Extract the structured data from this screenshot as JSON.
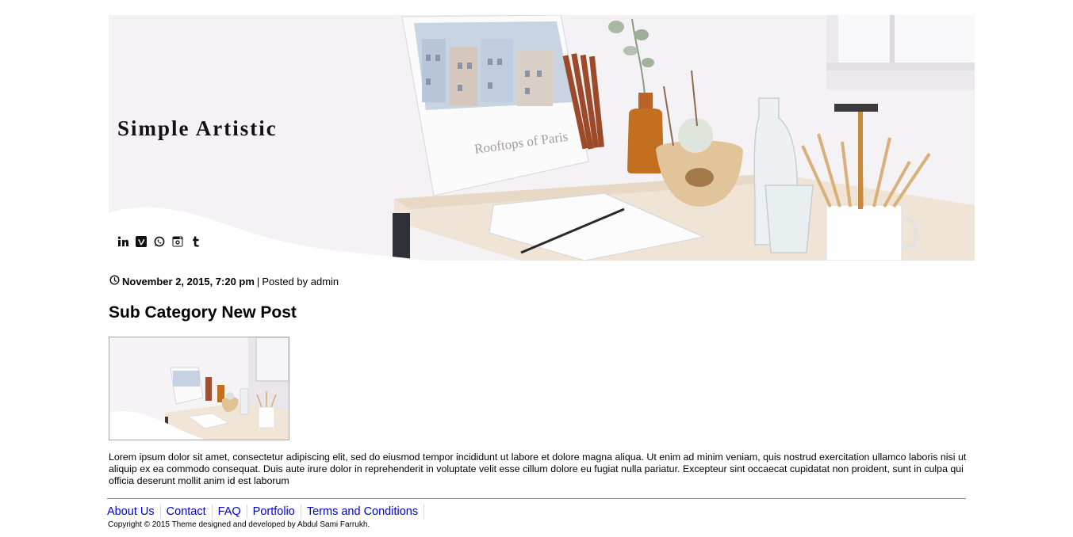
{
  "header": {
    "site_title": "Simple Artistic",
    "banner_image": "desk-workspace-photo",
    "book_cover_text": "Rooftops of Paris"
  },
  "social": [
    {
      "name": "linkedin-icon",
      "glyph": "in"
    },
    {
      "name": "vimeo-icon",
      "glyph": "v"
    },
    {
      "name": "whatsapp-icon",
      "glyph": "whatsapp"
    },
    {
      "name": "instagram-icon",
      "glyph": "camera"
    },
    {
      "name": "tumblr-icon",
      "glyph": "t"
    }
  ],
  "post": {
    "clock_icon": "clock-icon",
    "date": "November 2, 2015, 7:20 pm",
    "separator": "|",
    "posted_by": "Posted by admin",
    "title": "Sub Category New Post",
    "thumbnail": "desk-workspace-thumbnail",
    "body": "Lorem ipsum dolor sit amet, consectetur adipiscing elit, sed do eiusmod tempor incididunt ut labore et dolore magna aliqua. Ut enim ad minim veniam, quis nostrud exercitation ullamco laboris nisi ut aliquip ex ea commodo consequat. Duis aute irure dolor in reprehenderit in voluptate velit esse cillum dolore eu fugiat nulla pariatur. Excepteur sint occaecat cupidatat non proident, sunt in culpa qui officia deserunt mollit anim id est laborum"
  },
  "footer": {
    "links": [
      "About Us",
      "Contact",
      "FAQ",
      "Portfolio",
      "Terms and Conditions"
    ],
    "copyright": "Copyright © 2015 Theme designed and developed by Abdul Sami Farrukh."
  },
  "colors": {
    "link": "#0000cc",
    "text": "#000000",
    "rule": "#888888"
  }
}
